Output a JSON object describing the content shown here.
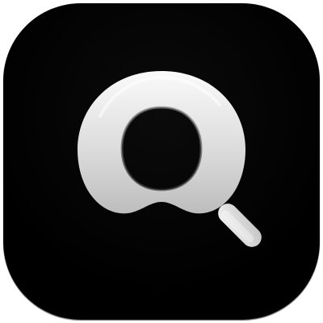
{
  "app_icon": {
    "name": "search-app-icon",
    "glyph": "magnifying-glass-icon",
    "background_color": "#000000",
    "glyph_color": "#e6e6e6"
  }
}
